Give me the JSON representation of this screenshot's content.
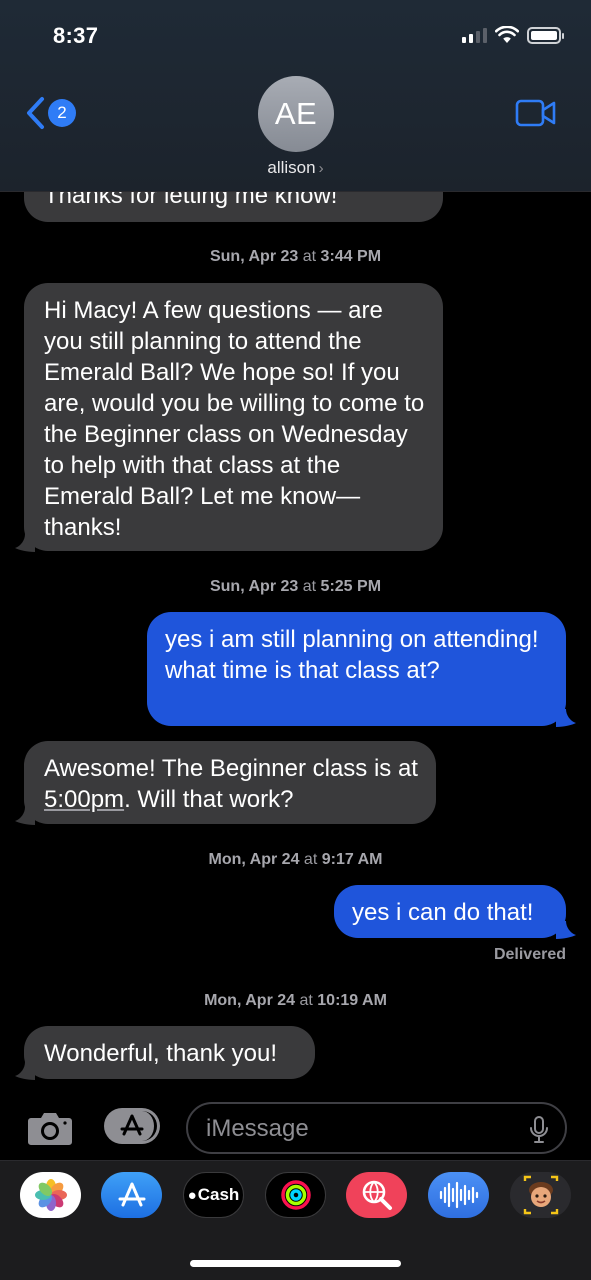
{
  "status_bar": {
    "time": "8:37"
  },
  "header": {
    "back_badge": "2",
    "avatar_initials": "AE",
    "contact_name": "allison",
    "contact_chevron": "›"
  },
  "conversation": {
    "partial_top_message": "Thanks for letting me know!",
    "timestamps": [
      {
        "day": "Sun, Apr 23",
        "at": "at",
        "time": "3:44 PM"
      },
      {
        "day": "Sun, Apr 23",
        "at": "at",
        "time": "5:25 PM"
      },
      {
        "day": "Mon, Apr 24",
        "at": "at",
        "time": "9:17 AM"
      },
      {
        "day": "Mon, Apr 24",
        "at": "at",
        "time": "10:19 AM"
      }
    ],
    "messages": [
      {
        "direction": "incoming",
        "text": "Hi Macy! A few questions — are you still planning to attend the Emerald Ball? We hope so! If you are, would you be willing to come to the Beginner class on Wednesday to help with that class at the Emerald Ball? Let me know— thanks!"
      },
      {
        "direction": "outgoing",
        "text": "yes i am still planning on attending! what time is that class at?"
      },
      {
        "direction": "incoming",
        "text_before": "Awesome! The Beginner class is at ",
        "link": "5:00pm",
        "text_after": ". Will that work?"
      },
      {
        "direction": "outgoing",
        "text": "yes i can do that!"
      },
      {
        "direction": "incoming",
        "text": "Wonderful, thank you!"
      }
    ],
    "delivered_label": "Delivered"
  },
  "input_bar": {
    "placeholder": "iMessage"
  },
  "app_tray": {
    "apps": [
      "photos-app",
      "app-store-app",
      "apple-cash-app",
      "activity-app",
      "images-search-app",
      "audio-message-app",
      "memoji-app"
    ],
    "cash_label": "Cash"
  },
  "colors": {
    "incoming_bubble": "#3a3a3c",
    "outgoing_bubble": "#1f55db",
    "accent": "#2f7cf6"
  }
}
